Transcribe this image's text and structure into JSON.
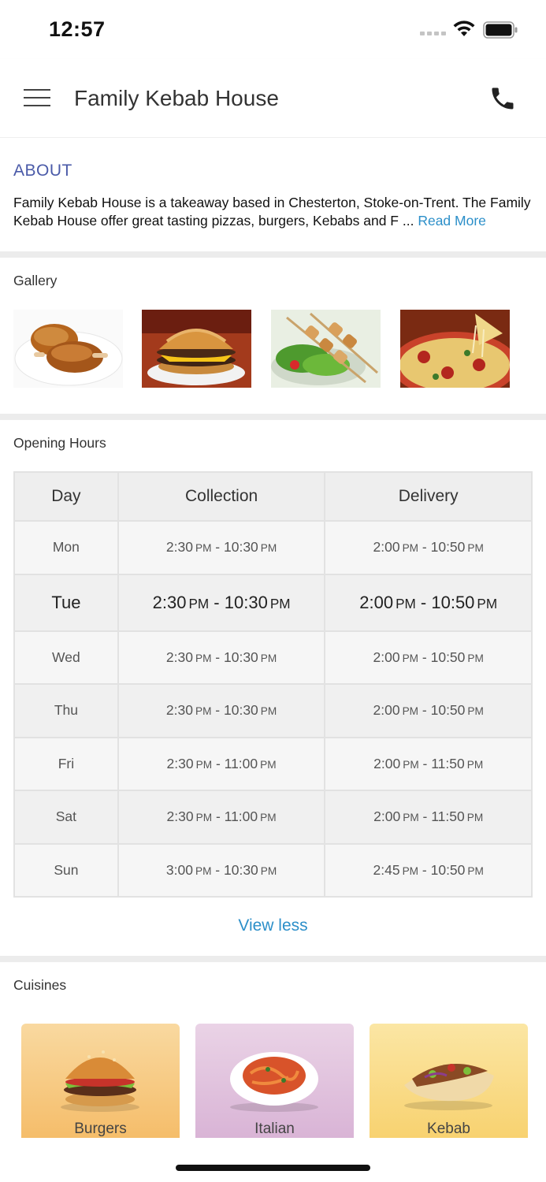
{
  "status_bar": {
    "time": "12:57"
  },
  "header": {
    "title": "Family Kebab House"
  },
  "about": {
    "heading": "ABOUT",
    "text": "Family Kebab House is a takeaway based in Chesterton, Stoke-on-Trent. The Family Kebab House offer great tasting pizzas, burgers, Kebabs and F ...",
    "read_more": "Read More"
  },
  "gallery": {
    "label": "Gallery",
    "items": [
      "fried-chicken",
      "burger",
      "kebab-skewers",
      "pizza"
    ]
  },
  "opening_hours": {
    "label": "Opening Hours",
    "columns": [
      "Day",
      "Collection",
      "Delivery"
    ],
    "rows": [
      {
        "day": "Mon",
        "collection_open": "2:30",
        "collection_close": "10:30",
        "delivery_open": "2:00",
        "delivery_close": "10:50",
        "today": false
      },
      {
        "day": "Tue",
        "collection_open": "2:30",
        "collection_close": "10:30",
        "delivery_open": "2:00",
        "delivery_close": "10:50",
        "today": true
      },
      {
        "day": "Wed",
        "collection_open": "2:30",
        "collection_close": "10:30",
        "delivery_open": "2:00",
        "delivery_close": "10:50",
        "today": false
      },
      {
        "day": "Thu",
        "collection_open": "2:30",
        "collection_close": "10:30",
        "delivery_open": "2:00",
        "delivery_close": "10:50",
        "today": false
      },
      {
        "day": "Fri",
        "collection_open": "2:30",
        "collection_close": "11:00",
        "delivery_open": "2:00",
        "delivery_close": "11:50",
        "today": false
      },
      {
        "day": "Sat",
        "collection_open": "2:30",
        "collection_close": "11:00",
        "delivery_open": "2:00",
        "delivery_close": "11:50",
        "today": false
      },
      {
        "day": "Sun",
        "collection_open": "3:00",
        "collection_close": "10:30",
        "delivery_open": "2:45",
        "delivery_close": "10:50",
        "today": false
      }
    ],
    "period": "PM",
    "view_less": "View less"
  },
  "cuisines": {
    "label": "Cuisines",
    "items": [
      {
        "label": "Burgers"
      },
      {
        "label": "Italian"
      },
      {
        "label": "Kebab"
      }
    ]
  },
  "colors": {
    "heading_blue": "#4a5aa8",
    "link_blue": "#2c8fc9",
    "divider": "#ececec"
  }
}
